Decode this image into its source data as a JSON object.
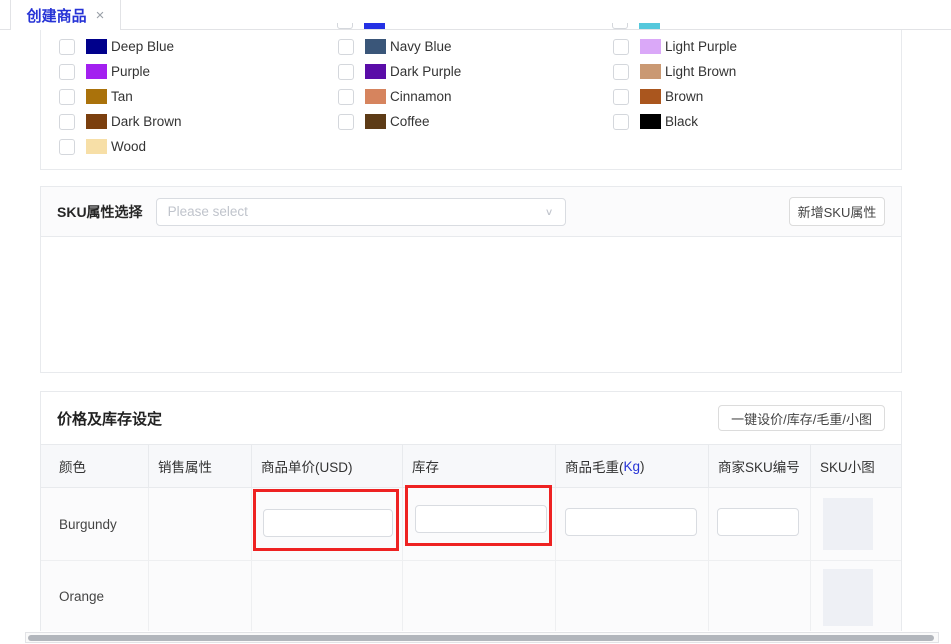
{
  "accent_color": "#2633d6",
  "tab": {
    "label": "创建商品",
    "close": "×"
  },
  "colors": {
    "partial_swatches": [
      {
        "name": "partial-swatch-blue",
        "color": "#2431e4"
      },
      {
        "name": "partial-swatch-cyan",
        "color": "#55c8dc"
      }
    ],
    "columns": [
      [
        {
          "label": "Deep Blue",
          "color": "#00008b"
        },
        {
          "label": "Purple",
          "color": "#a320f0"
        },
        {
          "label": "Tan",
          "color": "#aa720b"
        },
        {
          "label": "Dark Brown",
          "color": "#7b3f0e"
        },
        {
          "label": "Wood",
          "color": "#f7dfa7"
        }
      ],
      [
        {
          "label": "Navy Blue",
          "color": "#3a5679"
        },
        {
          "label": "Dark Purple",
          "color": "#5a0ca8"
        },
        {
          "label": "Cinnamon",
          "color": "#d6845e"
        },
        {
          "label": "Coffee",
          "color": "#5d3b16"
        }
      ],
      [
        {
          "label": "Light Purple",
          "color": "#daa8f8"
        },
        {
          "label": "Light Brown",
          "color": "#ca9973"
        },
        {
          "label": "Brown",
          "color": "#aa561e"
        },
        {
          "label": "Black",
          "color": "#000000"
        }
      ]
    ]
  },
  "sku_selector": {
    "label": "SKU属性选择",
    "placeholder": "Please select",
    "chevron": "∨",
    "add_button": "新增SKU属性"
  },
  "pricing": {
    "title": "价格及库存设定",
    "bulk_button": "一键设价/库存/毛重/小图",
    "highlight_color": "#ee2222",
    "table": {
      "headers": [
        {
          "label": "颜色"
        },
        {
          "label": "销售属性"
        },
        {
          "label": "商品单价(USD)"
        },
        {
          "label": "库存"
        },
        {
          "label": "商品毛重(Kg)",
          "accent_text": "Kg"
        },
        {
          "label": "商家SKU编号"
        },
        {
          "label": "SKU小图"
        }
      ],
      "rows": [
        {
          "name": "Burgundy",
          "has_inputs": true,
          "has_thumb": true
        },
        {
          "name": "Orange",
          "has_inputs": false,
          "has_thumb": true
        }
      ]
    }
  }
}
